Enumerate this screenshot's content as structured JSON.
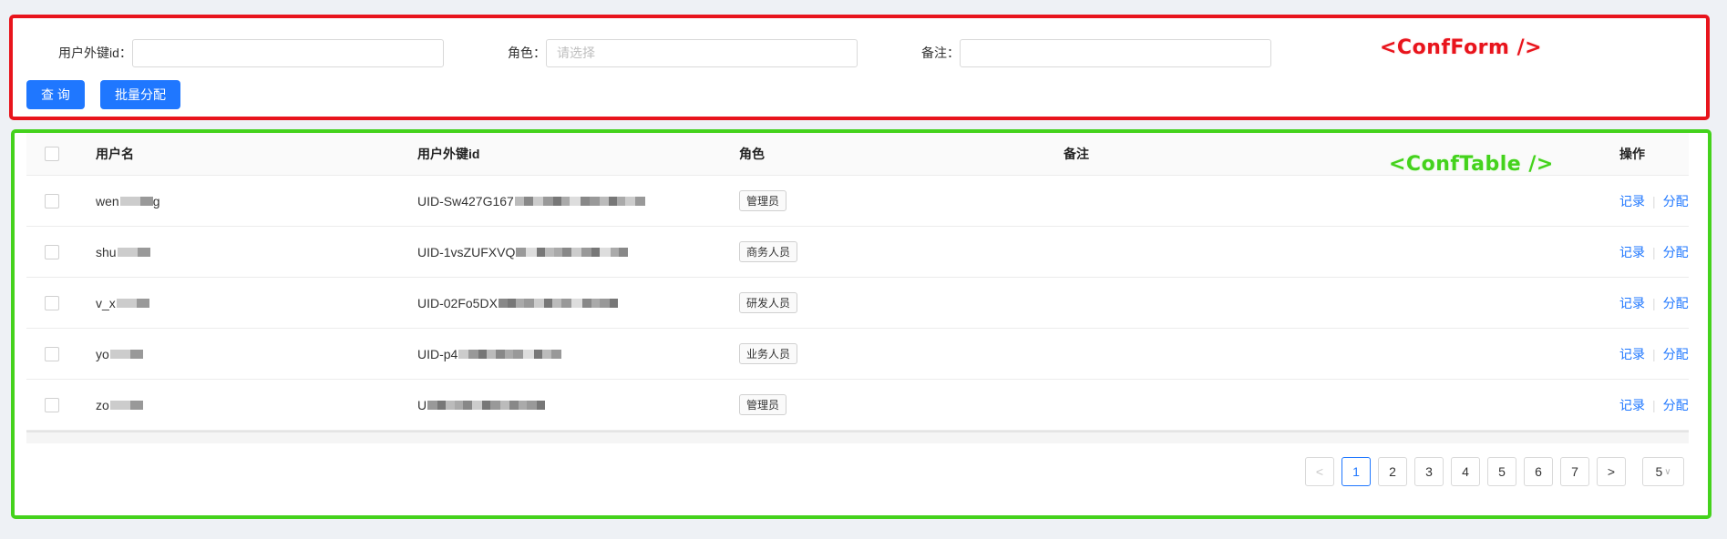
{
  "form": {
    "annotation": "<ConfForm />",
    "fields": [
      {
        "label": "用户外键id：",
        "value": "",
        "placeholder": ""
      },
      {
        "label": "角色：",
        "value": "",
        "placeholder": "请选择"
      },
      {
        "label": "备注：",
        "value": "",
        "placeholder": ""
      }
    ],
    "query_label": "查 询",
    "batch_label": "批量分配"
  },
  "table": {
    "annotation": "<ConfTable />",
    "columns": {
      "username": "用户名",
      "uid": "用户外键id",
      "role": "角色",
      "note": "备注",
      "op": "操作"
    },
    "rows": [
      {
        "username": "wen",
        "username_tail": "g",
        "uid": "UID-Sw427G167",
        "role": "管理员",
        "note": "",
        "op1": "记录",
        "op2": "分配"
      },
      {
        "username": "shu",
        "username_tail": "",
        "uid": "UID-1vsZUFXVQ",
        "role": "商务人员",
        "note": "",
        "op1": "记录",
        "op2": "分配"
      },
      {
        "username": "v_x",
        "username_tail": "",
        "uid": "UID-02Fo5DX",
        "role": "研发人员",
        "note": "",
        "op1": "记录",
        "op2": "分配"
      },
      {
        "username": "yo",
        "username_tail": "",
        "uid": "UID-p4",
        "role": "业务人员",
        "note": "",
        "op1": "记录",
        "op2": "分配"
      },
      {
        "username": "zo",
        "username_tail": "",
        "uid": "U",
        "role": "管理员",
        "note": "",
        "op1": "记录",
        "op2": "分配"
      }
    ]
  },
  "pagination": {
    "prev": "<",
    "next": ">",
    "pages": [
      "1",
      "2",
      "3",
      "4",
      "5",
      "6",
      "7"
    ],
    "current": "1",
    "page_size": "5"
  },
  "colors": {
    "primary": "#1f77ff",
    "form_border": "#e8141c",
    "table_border": "#44d21c"
  }
}
